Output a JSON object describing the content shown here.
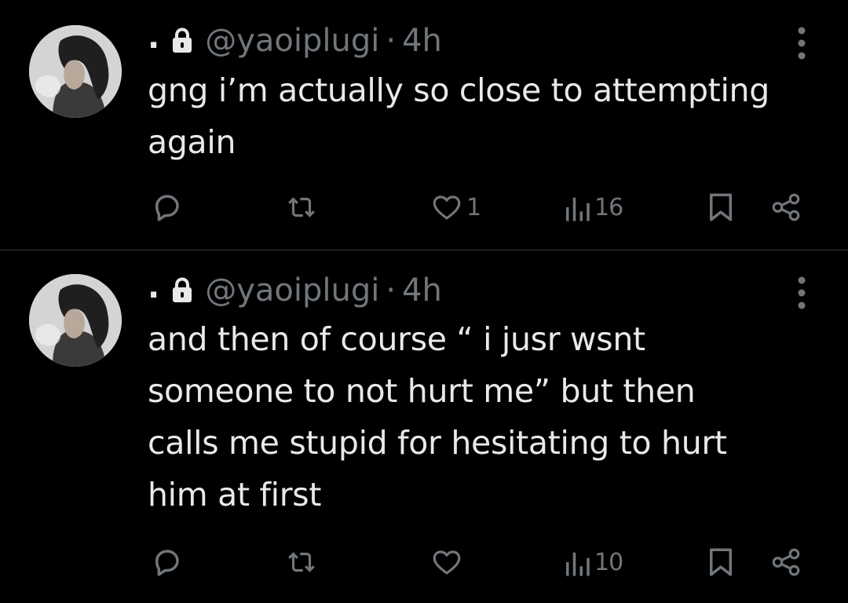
{
  "tweets": [
    {
      "display_name": ".",
      "handle": "@yaoiplugi",
      "separator": "·",
      "time": "4h",
      "text": "gng i’m actually so close to attempting\nagain",
      "likes": "1",
      "views": "16"
    },
    {
      "display_name": ".",
      "handle": "@yaoiplugi",
      "separator": "·",
      "time": "4h",
      "text": "and then of course “ i jusr wsnt\nsomeone to not hurt me” but then\ncalls me stupid for hesitating to hurt\nhim at first",
      "likes": "",
      "views": "10"
    }
  ],
  "colors": {
    "background": "#000000",
    "text_primary": "#e7e9ea",
    "text_secondary": "#71767b",
    "divider": "#2f3336"
  },
  "icons": [
    "avatar",
    "lock-icon",
    "more-icon",
    "reply-icon",
    "retweet-icon",
    "like-icon",
    "views-icon",
    "bookmark-icon",
    "share-icon"
  ]
}
